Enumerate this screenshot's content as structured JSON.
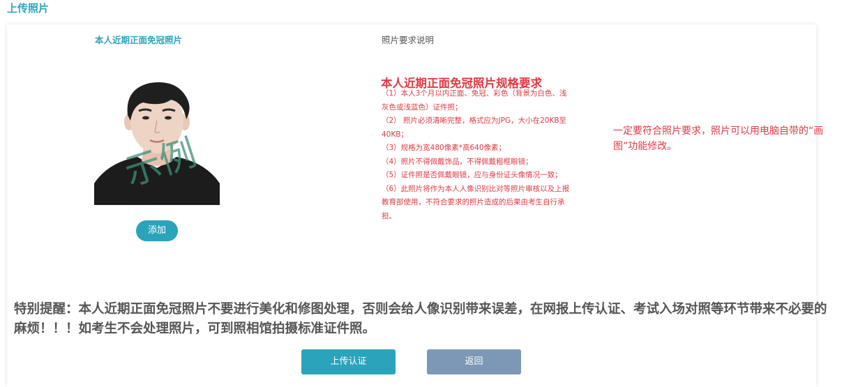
{
  "page": {
    "title": "上传照片"
  },
  "columns": {
    "left_header": "本人近期正面免冠照片",
    "right_header": "照片要求说明"
  },
  "photo": {
    "watermark_text": "示例",
    "background_color": "#ffffff",
    "shirt_color": "#1c1c1c",
    "hair_color": "#1f1f1f",
    "skin_color": "#eed4c4",
    "watermark_color": "#3d8f7a"
  },
  "actions": {
    "add_label": "添加",
    "upload_label": "上传认证",
    "back_label": "返回"
  },
  "spec": {
    "title": "本人近期正面免冠照片规格要求",
    "lines": [
      "（1）本人3个月以内正面、免冠、彩色（背景为白色、浅灰色或浅蓝色）证件照；",
      "（2） 照片必须清晰完整，格式应为JPG，大小在20KB至40KB；",
      "（3）规格为宽480像素*高640像素；",
      "（4）照片不得佩戴饰品，不得佩戴粗框眼镜；",
      "（5）证件照是否佩戴眼镜，应与身份证头像情况一致；",
      "（6）此照片将作为本人人像识别比对等照片审核以及上报教育部使用，不符合要求的照片造成的后果由考生自行承担。"
    ]
  },
  "note": "一定要符合照片要求，照片可以用电脑自带的“画图”功能修改。",
  "reminder": "特别提醒：本人近期正面免冠照片不要进行美化和修图处理，否则会给人像识别带来误差，在网报上传认证、考试入场对照等环节带来不必要的麻烦！！！如考生不会处理照片，可到照相馆拍摄标准证件照。",
  "colors": {
    "accent": "#2fa3bf",
    "button_primary": "#2aa3bb",
    "button_secondary": "#7d98b6",
    "warning_red": "#e03a45",
    "text_gray": "#555555"
  }
}
